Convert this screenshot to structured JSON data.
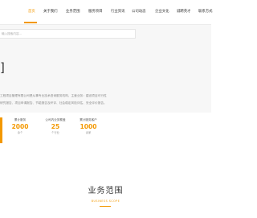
{
  "nav": {
    "items": [
      "首页",
      "关于我们",
      "业务范围",
      "服务项目",
      "行业资讯",
      "公司动态",
      "企业文化",
      "诚聘英才",
      "联系方式"
    ],
    "active_index": 0,
    "accent_color": "#f39800"
  },
  "search": {
    "placeholder": "输入搜索内容..."
  },
  "intro": {
    "bracket": "]",
    "text": "工程项目管理有限公司是从事专业技术咨询服务机构，主营业务：建设项目可行性研究报告、项目申请报告、节能报告及环评、社会稳定风险评估、安全评价报告。"
  },
  "stats": [
    {
      "label": "累计服务",
      "value": "2000",
      "unit": "余个"
    },
    {
      "label": "公司内业务覆盖",
      "value": "25",
      "unit": "个行业"
    },
    {
      "label": "累计服务客户",
      "value": "1000",
      "unit": "余家"
    }
  ],
  "section": {
    "title": "业务范围",
    "subtitle": "BUSINESS SCOPE"
  }
}
